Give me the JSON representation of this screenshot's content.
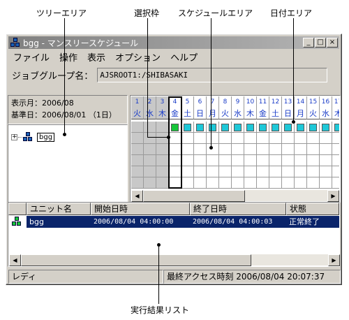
{
  "annotations": {
    "tree_area": "ツリーエリア",
    "selection_frame": "選択枠",
    "schedule_area": "スケジュールエリア",
    "date_area": "日付エリア",
    "result_list": "実行結果リスト"
  },
  "window": {
    "title": "bgg - マンスリースケジュール",
    "buttons": {
      "minimize": "_",
      "maximize": "□",
      "close": "×"
    }
  },
  "menu": [
    "ファイル",
    "操作",
    "表示",
    "オプション",
    "ヘルプ"
  ],
  "job_group": {
    "label": "ジョブグループ名：",
    "value": "AJSROOT1:/SHIBASAKI"
  },
  "info": {
    "display_month": "表示月：2006/08",
    "base_day": "基準日：2006/08/01 （1日）"
  },
  "tree": {
    "node": "bgg"
  },
  "schedule": {
    "days": [
      {
        "n": "1",
        "d": "火"
      },
      {
        "n": "2",
        "d": "水"
      },
      {
        "n": "3",
        "d": "木"
      },
      {
        "n": "4",
        "d": "金"
      },
      {
        "n": "5",
        "d": "土"
      },
      {
        "n": "6",
        "d": "日"
      },
      {
        "n": "7",
        "d": "月"
      },
      {
        "n": "8",
        "d": "火"
      },
      {
        "n": "9",
        "d": "水"
      },
      {
        "n": "10",
        "d": "木"
      },
      {
        "n": "11",
        "d": "金"
      },
      {
        "n": "12",
        "d": "土"
      },
      {
        "n": "13",
        "d": "日"
      },
      {
        "n": "14",
        "d": "月"
      },
      {
        "n": "15",
        "d": "火"
      },
      {
        "n": "16",
        "d": "水"
      },
      {
        "n": "17",
        "d": "木"
      }
    ],
    "past_day_count": 3,
    "selected_day": "4",
    "scheduled_from_day": "4"
  },
  "results": {
    "columns": [
      "ユニット名",
      "開始日時",
      "終了日時",
      "状態"
    ],
    "rows": [
      {
        "unit": "bgg",
        "start": "2006/08/04  04:00:00",
        "end": "2006/08/04  04:00:03",
        "status": "正常終了"
      }
    ]
  },
  "statusbar": {
    "left": "レディ",
    "right": "最終アクセス時刻 2006/08/04  20:07:37"
  },
  "colors": {
    "scheduled": "#1ec8d8",
    "executed": "#17c63a",
    "selected_row": "#0a246a",
    "day_text": "#1a3cc8"
  }
}
